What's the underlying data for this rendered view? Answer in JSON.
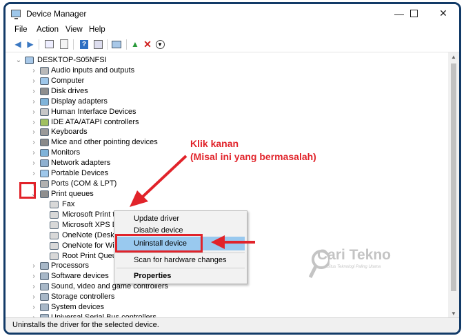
{
  "window": {
    "title": "Device Manager"
  },
  "menu": [
    "File",
    "Action",
    "View",
    "Help"
  ],
  "tree": {
    "root": "DESKTOP-S05NFSI",
    "categories": [
      {
        "label": "Audio inputs and outputs",
        "icon": "speaker-icon"
      },
      {
        "label": "Computer",
        "icon": "computer-icon"
      },
      {
        "label": "Disk drives",
        "icon": "disk-drive-icon"
      },
      {
        "label": "Display adapters",
        "icon": "display-adapter-icon"
      },
      {
        "label": "Human Interface Devices",
        "icon": "hid-icon"
      },
      {
        "label": "IDE ATA/ATAPI controllers",
        "icon": "ide-controller-icon"
      },
      {
        "label": "Keyboards",
        "icon": "keyboard-icon"
      },
      {
        "label": "Mice and other pointing devices",
        "icon": "mouse-icon"
      },
      {
        "label": "Monitors",
        "icon": "monitor-icon"
      },
      {
        "label": "Network adapters",
        "icon": "network-adapter-icon"
      },
      {
        "label": "Portable Devices",
        "icon": "portable-device-icon"
      },
      {
        "label": "Ports (COM & LPT)",
        "icon": "port-icon"
      },
      {
        "label": "Print queues",
        "icon": "printer-icon",
        "expanded": true
      }
    ],
    "print_queue_children": [
      "Fax",
      "Microsoft Print to PDF",
      "Microsoft XPS Document Writer",
      "OneNote (Desktop)",
      "OneNote for Windows 10",
      "Root Print Queue"
    ],
    "categories_after": [
      {
        "label": "Processors",
        "icon": "processor-icon"
      },
      {
        "label": "Software devices",
        "icon": "software-device-icon"
      },
      {
        "label": "Sound, video and game controllers",
        "icon": "sound-icon"
      },
      {
        "label": "Storage controllers",
        "icon": "storage-controller-icon"
      },
      {
        "label": "System devices",
        "icon": "system-device-icon"
      },
      {
        "label": "Universal Serial Bus controllers",
        "icon": "usb-icon"
      }
    ]
  },
  "context_menu": {
    "update_driver": "Update driver",
    "disable_device": "Disable device",
    "uninstall_device": "Uninstall device",
    "scan": "Scan for hardware changes",
    "properties": "Properties"
  },
  "annotation": {
    "line1": "Klik kanan",
    "line2": "(Misal ini yang bermasalah)"
  },
  "watermark": {
    "title": "Cari Tekno",
    "subtitle": "Situs Teknologi Paling Utama"
  },
  "status": "Uninstalls the driver for the selected device.",
  "colors": {
    "annotation_red": "#e1232a",
    "highlight_blue": "#99c9ef",
    "frame_border": "#123a67"
  }
}
